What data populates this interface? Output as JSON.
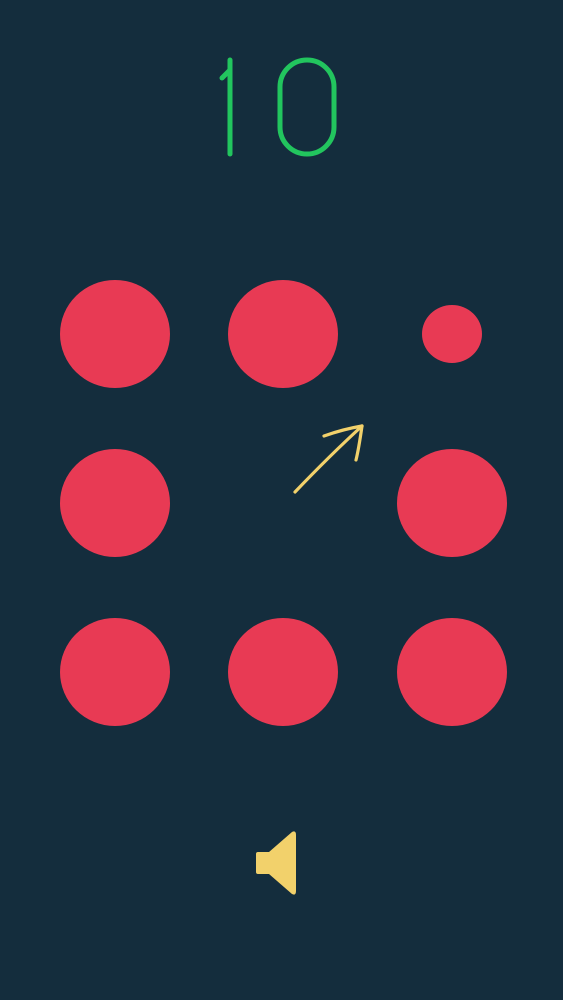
{
  "score": {
    "value": "10",
    "color": "#22c55e"
  },
  "board": {
    "dot_color": "#e83a54",
    "rows": [
      [
        "dot",
        "dot",
        "dot-small"
      ],
      [
        "dot",
        "arrow",
        "dot"
      ],
      [
        "dot",
        "dot",
        "dot"
      ]
    ]
  },
  "arrow": {
    "icon": "arrow-up-right-icon",
    "color": "#f2d16b"
  },
  "controls": {
    "sound_icon": "speaker-icon",
    "sound_color": "#f2d16b"
  },
  "colors": {
    "background": "#142d3d"
  }
}
